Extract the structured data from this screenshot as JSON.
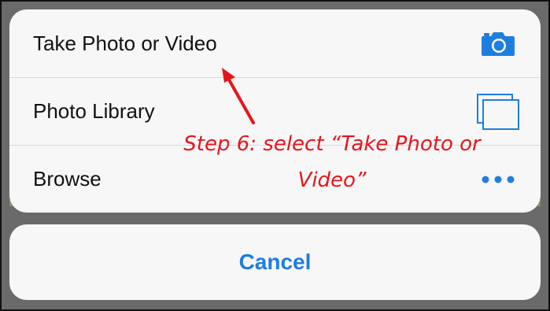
{
  "action_sheet": {
    "options": [
      {
        "label": "Take Photo or Video",
        "icon": "camera-icon"
      },
      {
        "label": "Photo Library",
        "icon": "photo-library-icon"
      },
      {
        "label": "Browse",
        "icon": "more-icon"
      }
    ],
    "cancel_label": "Cancel"
  },
  "annotation": {
    "line1": "Step 6: select “Take Photo or",
    "line2": "Video”"
  },
  "colors": {
    "accent": "#1e7ee0",
    "annotation": "#e8141c"
  }
}
